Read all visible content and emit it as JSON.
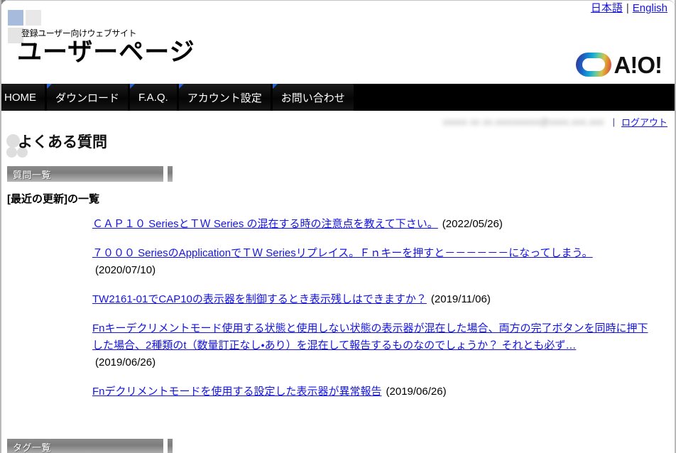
{
  "header": {
    "lang": {
      "japanese": "日本語",
      "separator": "|",
      "english": "English"
    },
    "site_subtitle": "登録ユーザー向けウェブサイト",
    "site_title": "ユーザーページ",
    "logo_wordmark": "A!O!"
  },
  "nav": {
    "items": [
      {
        "label": "HOME"
      },
      {
        "label": "ダウンロード"
      },
      {
        "label": "F.A.Q."
      },
      {
        "label": "アカウント設定"
      },
      {
        "label": "お問い合わせ"
      }
    ]
  },
  "userbar": {
    "user_id": "xxxxx xx  xx.xxxxxxxxx@xxxx.xxx.xxx",
    "divider": "|",
    "logout_label": "ログアウト"
  },
  "page": {
    "title": "よくある質問",
    "section_label": "質問一覧",
    "list_heading": "[最近の更新]の一覧",
    "bottom_section_label": "タグ一覧"
  },
  "faq": {
    "items": [
      {
        "text": "ＣＡＰ１０ SeriesとＴＷ Series の混在する時の注意点を教えて下さい。",
        "date": "(2022/05/26)",
        "wrapped": false
      },
      {
        "text": "７０００ SeriesのApplicationでＴＷ Seriesリプレイス。Ｆｎキーを押すと－－－－－－になってしまう。",
        "date": "(2020/07/10)",
        "wrapped": true
      },
      {
        "text": "TW2161-01でCAP10の表示器を制御するとき表示残しはできますか？",
        "date": "(2019/11/06)",
        "wrapped": false
      },
      {
        "text": "Fnキーデクリメントモード使用する状態と使用しない状態の表示器が混在した場合、両方の完了ボタンを同時に押下した場合、2種類のt（数量訂正なし・あり）を混在して報告するものなのでしょうか？ それとも必ず…",
        "date": "(2019/06/26)",
        "wrapped": true
      },
      {
        "text": "Fnデクリメントモードを使用する設定した表示器が異常報告",
        "date": "(2019/06/26)",
        "wrapped": false
      }
    ]
  },
  "colors": {
    "link": "#1414e0",
    "nav_background": "#000000",
    "section_bar": "#7d7d7d",
    "accent_square": "#a7bbdd"
  }
}
